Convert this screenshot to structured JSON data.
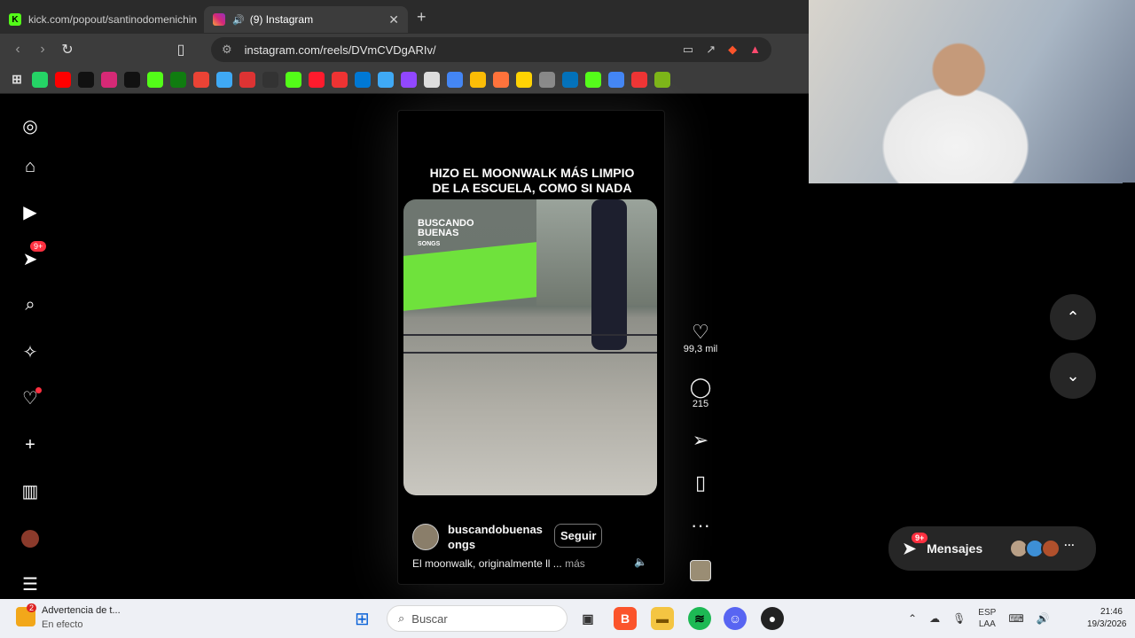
{
  "browser": {
    "tabs": [
      {
        "title": "kick.com/popout/santinodomenichin",
        "active": false
      },
      {
        "title": "(9) Instagram",
        "active": true
      }
    ],
    "url": "instagram.com/reels/DVmCVDgARIv/",
    "bookmark_icons": [
      "grid",
      "whatsapp",
      "youtube",
      "tiktok",
      "instagram",
      "x",
      "kick",
      "xbox",
      "gmail",
      "extension",
      "chart",
      "github",
      "kick",
      "opera",
      "generic",
      "windows",
      "extension",
      "twitch",
      "chrome",
      "docs",
      "drive",
      "firefox",
      "dlive",
      "generic",
      "paypal",
      "kick",
      "docs",
      "download",
      "download"
    ]
  },
  "sidebar": {
    "items": [
      {
        "icon": "instagram-icon"
      },
      {
        "icon": "home-icon"
      },
      {
        "icon": "reels-icon"
      },
      {
        "icon": "messages-icon",
        "badge": "9+"
      },
      {
        "icon": "search-icon"
      },
      {
        "icon": "explore-icon"
      },
      {
        "icon": "notifications-icon"
      },
      {
        "icon": "create-icon"
      },
      {
        "icon": "dashboard-icon"
      },
      {
        "icon": "profile-icon"
      },
      {
        "icon": "more-icon"
      }
    ]
  },
  "reel": {
    "headline": "HIZO EL MOONWALK MÁS LIMPIO DE LA ESCUELA, COMO SI NADA",
    "watermark_line1": "BUSCANDO",
    "watermark_line2": "BUENAS",
    "watermark_line3": "SONGS",
    "username": "buscandobuenas ongs",
    "follow_label": "Seguir",
    "description": "El moonwalk, originalmente ll ...",
    "more_label": "más",
    "likes": "99,3 mil",
    "comments": "215"
  },
  "messages": {
    "label": "Mensajes",
    "badge": "9+"
  },
  "taskbar": {
    "notification_title": "Advertencia de t...",
    "notification_subtitle": "En efecto",
    "notification_badge": "2",
    "search_placeholder": "Buscar",
    "lang_line1": "ESP",
    "lang_line2": "LAA",
    "time": "21:46",
    "date": "19/3/2026"
  }
}
